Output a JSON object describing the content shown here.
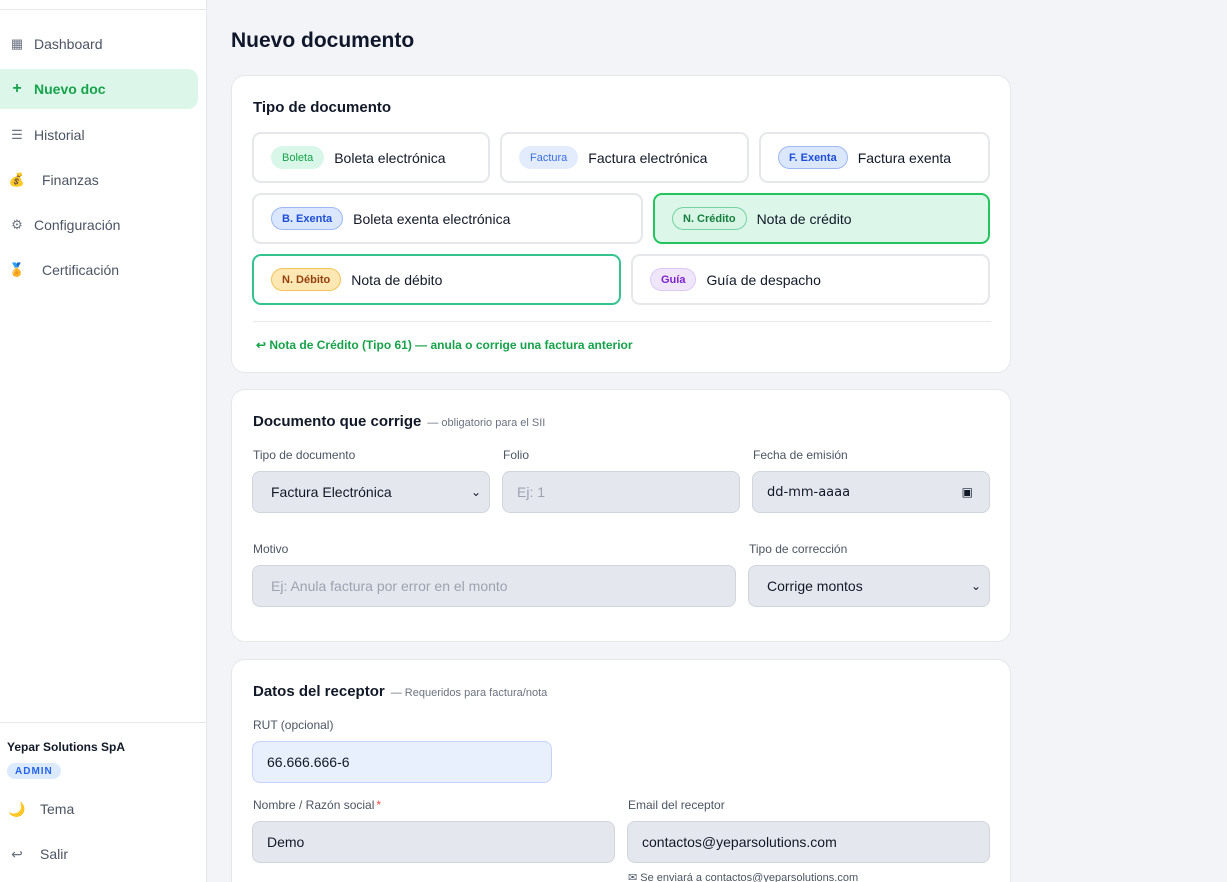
{
  "sidebar": {
    "items": [
      {
        "label": "Dashboard",
        "icon": "grid-icon",
        "glyph": "▦"
      },
      {
        "label": "Nuevo doc",
        "icon": "plus-icon",
        "glyph": "+"
      },
      {
        "label": "Historial",
        "icon": "list-icon",
        "glyph": "☰"
      },
      {
        "label": "Finanzas",
        "icon": "money-bag-icon",
        "glyph": "💰"
      },
      {
        "label": "Configuración",
        "icon": "gear-icon",
        "glyph": "⚙"
      },
      {
        "label": "Certificación",
        "icon": "medal-icon",
        "glyph": "🏅"
      }
    ],
    "company": "Yepar Solutions SpA",
    "role": "ADMIN",
    "theme_label": "Tema",
    "theme_glyph": "🌙",
    "logout_label": "Salir",
    "logout_glyph": "↩"
  },
  "page": {
    "title": "Nuevo documento"
  },
  "tipo_documento": {
    "title": "Tipo de documento",
    "options": [
      {
        "badge": "Boleta",
        "label": "Boleta electrónica"
      },
      {
        "badge": "Factura",
        "label": "Factura electrónica"
      },
      {
        "badge": "F. Exenta",
        "label": "Factura exenta"
      },
      {
        "badge": "B. Exenta",
        "label": "Boleta exenta electrónica"
      },
      {
        "badge": "N. Crédito",
        "label": "Nota de crédito"
      },
      {
        "badge": "N. Débito",
        "label": "Nota de débito"
      },
      {
        "badge": "Guía",
        "label": "Guía de despacho"
      }
    ],
    "selected": "Nota de crédito",
    "hint": "↩ Nota de Crédito (Tipo 61) — anula o corrige una factura anterior"
  },
  "documento_corrige": {
    "title": "Documento que corrige",
    "subtitle": "— obligatorio para el SII",
    "tipo_label": "Tipo de documento",
    "tipo_value": "Factura Electrónica",
    "folio_label": "Folio",
    "folio_placeholder": "Ej: 1",
    "fecha_label": "Fecha de emisión",
    "fecha_placeholder": "dd-mm-aaaa",
    "motivo_label": "Motivo",
    "motivo_placeholder": "Ej: Anula factura por error en el monto",
    "correccion_label": "Tipo de corrección",
    "correccion_value": "Corrige montos"
  },
  "receptor": {
    "title": "Datos del receptor",
    "subtitle": "— Requeridos para factura/nota",
    "rut_label": "RUT (opcional)",
    "rut_value": "66.666.666-6",
    "nombre_label": "Nombre / Razón social",
    "nombre_required": "*",
    "nombre_value": "Demo",
    "email_label": "Email del receptor",
    "email_value": "contactos@yeparsolutions.com",
    "email_helper": "✉ Se enviará a contactos@yeparsolutions.com"
  },
  "colors": {
    "accent": "#16a34a",
    "accent_bg": "#dcf7ea"
  }
}
